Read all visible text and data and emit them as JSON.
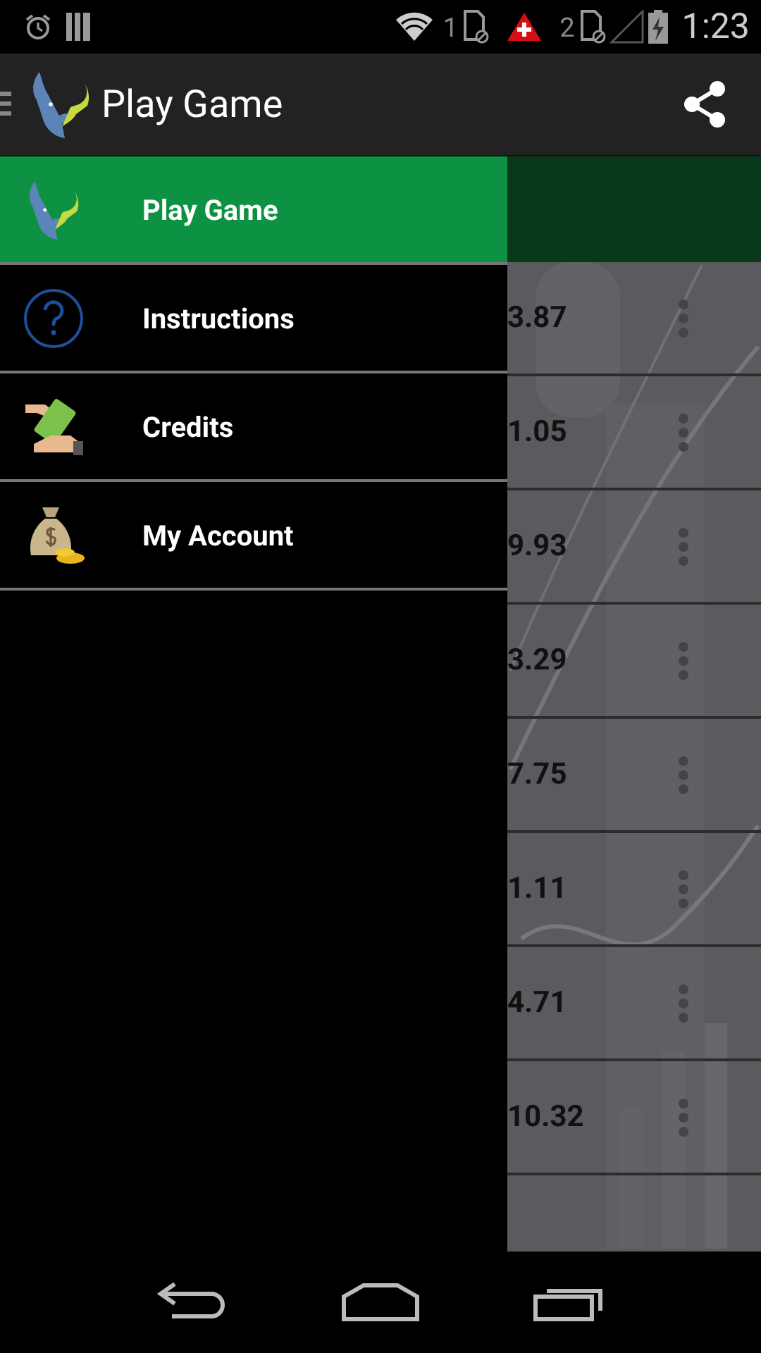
{
  "status_bar": {
    "sim_1_label": "1",
    "sim_2_label": "2",
    "time": "1:23"
  },
  "action_bar": {
    "title": "Play Game"
  },
  "drawer": {
    "items": [
      {
        "kind": "logo",
        "label": "Play Game",
        "selected": true
      },
      {
        "kind": "help",
        "label": "Instructions",
        "selected": false
      },
      {
        "kind": "cash",
        "label": "Credits",
        "selected": false
      },
      {
        "kind": "moneybag",
        "label": "My Account",
        "selected": false
      }
    ]
  },
  "list": {
    "rows": [
      {
        "value": "3.87"
      },
      {
        "value": "1.05"
      },
      {
        "value": "9.93"
      },
      {
        "value": "3.29"
      },
      {
        "value": "7.75"
      },
      {
        "value": "1.11"
      },
      {
        "value": "4.71"
      },
      {
        "value": "10.32"
      }
    ]
  }
}
